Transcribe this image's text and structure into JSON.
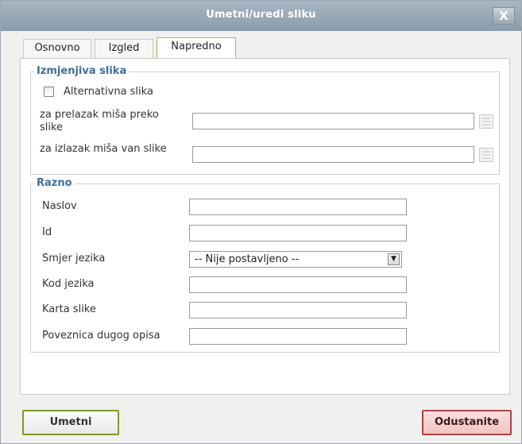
{
  "dialog": {
    "title": "Umetni/uredi sliku",
    "close_label": "X"
  },
  "tabs": [
    {
      "label": "Osnovno",
      "active": false
    },
    {
      "label": "Izgled",
      "active": false
    },
    {
      "label": "Napredno",
      "active": true
    }
  ],
  "swap_image": {
    "legend": "Izmjenjiva slika",
    "alt_image_label": "Alternativna slika",
    "alt_image_checked": false,
    "mouseover_label": "za prelazak miša preko slike",
    "mouseover_value": "",
    "mouseout_label": "za izlazak miša van slike",
    "mouseout_value": ""
  },
  "misc": {
    "legend": "Razno",
    "title_label": "Naslov",
    "title_value": "",
    "id_label": "Id",
    "id_value": "",
    "direction_label": "Smjer jezika",
    "direction_value": "-- Nije postavljeno --",
    "lang_code_label": "Kod jezika",
    "lang_code_value": "",
    "image_map_label": "Karta slike",
    "image_map_value": "",
    "long_desc_label": "Poveznica dugog opisa",
    "long_desc_value": ""
  },
  "actions": {
    "insert_label": "Umetni",
    "cancel_label": "Odustanite"
  }
}
